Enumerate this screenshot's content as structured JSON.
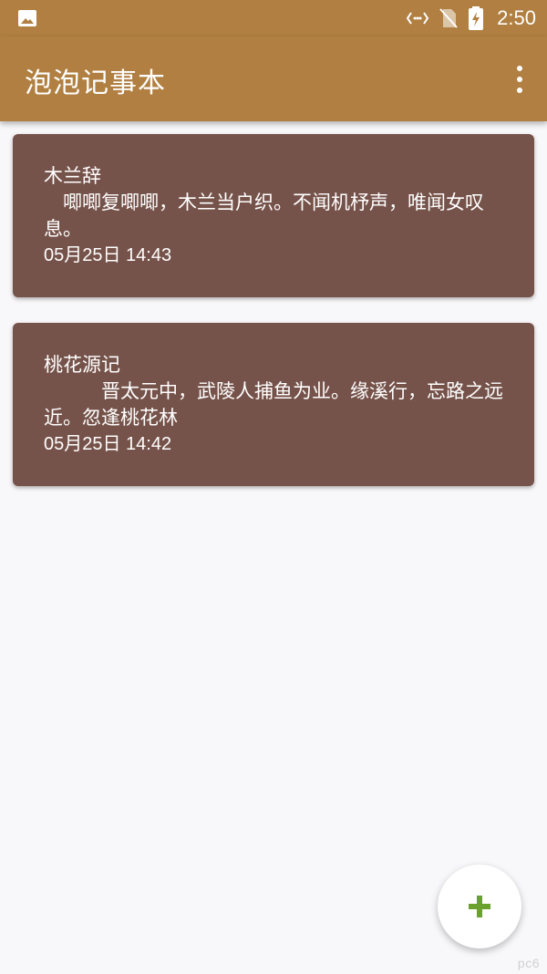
{
  "status_bar": {
    "time": "2:50",
    "icons": [
      "image-icon",
      "data-arrows-icon",
      "no-sim-icon",
      "battery-charging-icon"
    ]
  },
  "app_bar": {
    "title": "泡泡记事本",
    "menu_icon": "more-vert-icon"
  },
  "notes": [
    {
      "title": "木兰辞",
      "body": "　唧唧复唧唧，木兰当户织。不闻机杼声，唯闻女叹息。",
      "date": "05月25日 14:43"
    },
    {
      "title": "桃花源记",
      "body": "　　　晋太元中，武陵人捕鱼为业。缘溪行，忘路之远近。忽逢桃花林",
      "date": "05月25日 14:42"
    }
  ],
  "fab": {
    "icon": "plus-icon"
  },
  "watermark": "pc6",
  "colors": {
    "primary": "#b07f41",
    "card": "#76534a",
    "background": "#f8f7f9",
    "fab_icon": "#6aa12f"
  }
}
